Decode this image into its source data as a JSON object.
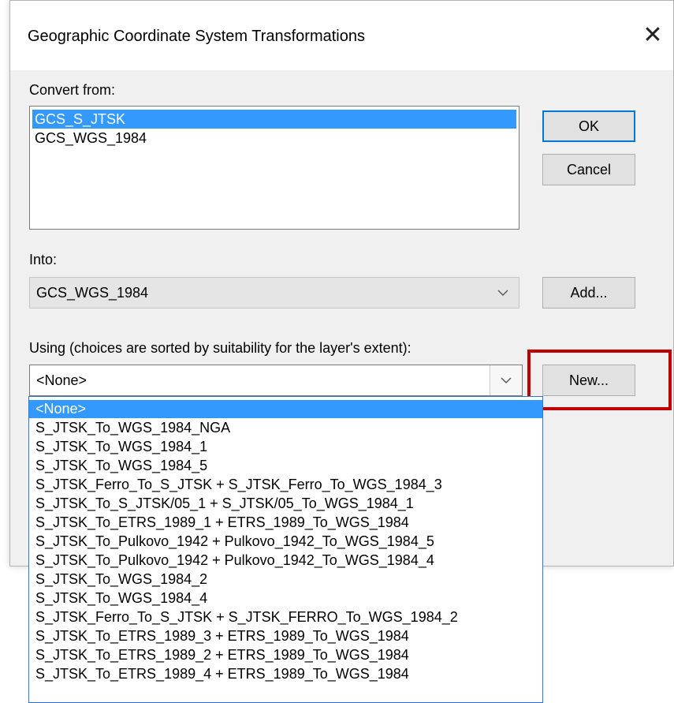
{
  "dialog": {
    "title": "Geographic Coordinate System Transformations",
    "close_glyph": "✕"
  },
  "convert_from": {
    "label": "Convert from:",
    "items": [
      "GCS_S_JTSK",
      "GCS_WGS_1984"
    ],
    "selected": "GCS_S_JTSK"
  },
  "into": {
    "label": "Into:",
    "value": "GCS_WGS_1984"
  },
  "using": {
    "label": "Using (choices are sorted by suitability for the layer's extent):",
    "value": "<None>",
    "options": [
      "<None>",
      "S_JTSK_To_WGS_1984_NGA",
      "S_JTSK_To_WGS_1984_1",
      "S_JTSK_To_WGS_1984_5",
      "S_JTSK_Ferro_To_S_JTSK + S_JTSK_Ferro_To_WGS_1984_3",
      "S_JTSK_To_S_JTSK/05_1 + S_JTSK/05_To_WGS_1984_1",
      "S_JTSK_To_ETRS_1989_1 + ETRS_1989_To_WGS_1984",
      "S_JTSK_To_Pulkovo_1942 + Pulkovo_1942_To_WGS_1984_5",
      "S_JTSK_To_Pulkovo_1942 + Pulkovo_1942_To_WGS_1984_4",
      "S_JTSK_To_WGS_1984_2",
      "S_JTSK_To_WGS_1984_4",
      "S_JTSK_Ferro_To_S_JTSK + S_JTSK_FERRO_To_WGS_1984_2",
      "S_JTSK_To_ETRS_1989_3 + ETRS_1989_To_WGS_1984",
      "S_JTSK_To_ETRS_1989_2 + ETRS_1989_To_WGS_1984",
      "S_JTSK_To_ETRS_1989_4 + ETRS_1989_To_WGS_1984"
    ]
  },
  "buttons": {
    "ok": "OK",
    "cancel": "Cancel",
    "add": "Add...",
    "new": "New..."
  },
  "icons": {
    "close": "close-icon",
    "dropdown": "chevron-down-icon"
  },
  "colors": {
    "selection": "#3399ff",
    "highlight_border": "#c00000",
    "default_button_border": "#0078d7"
  }
}
